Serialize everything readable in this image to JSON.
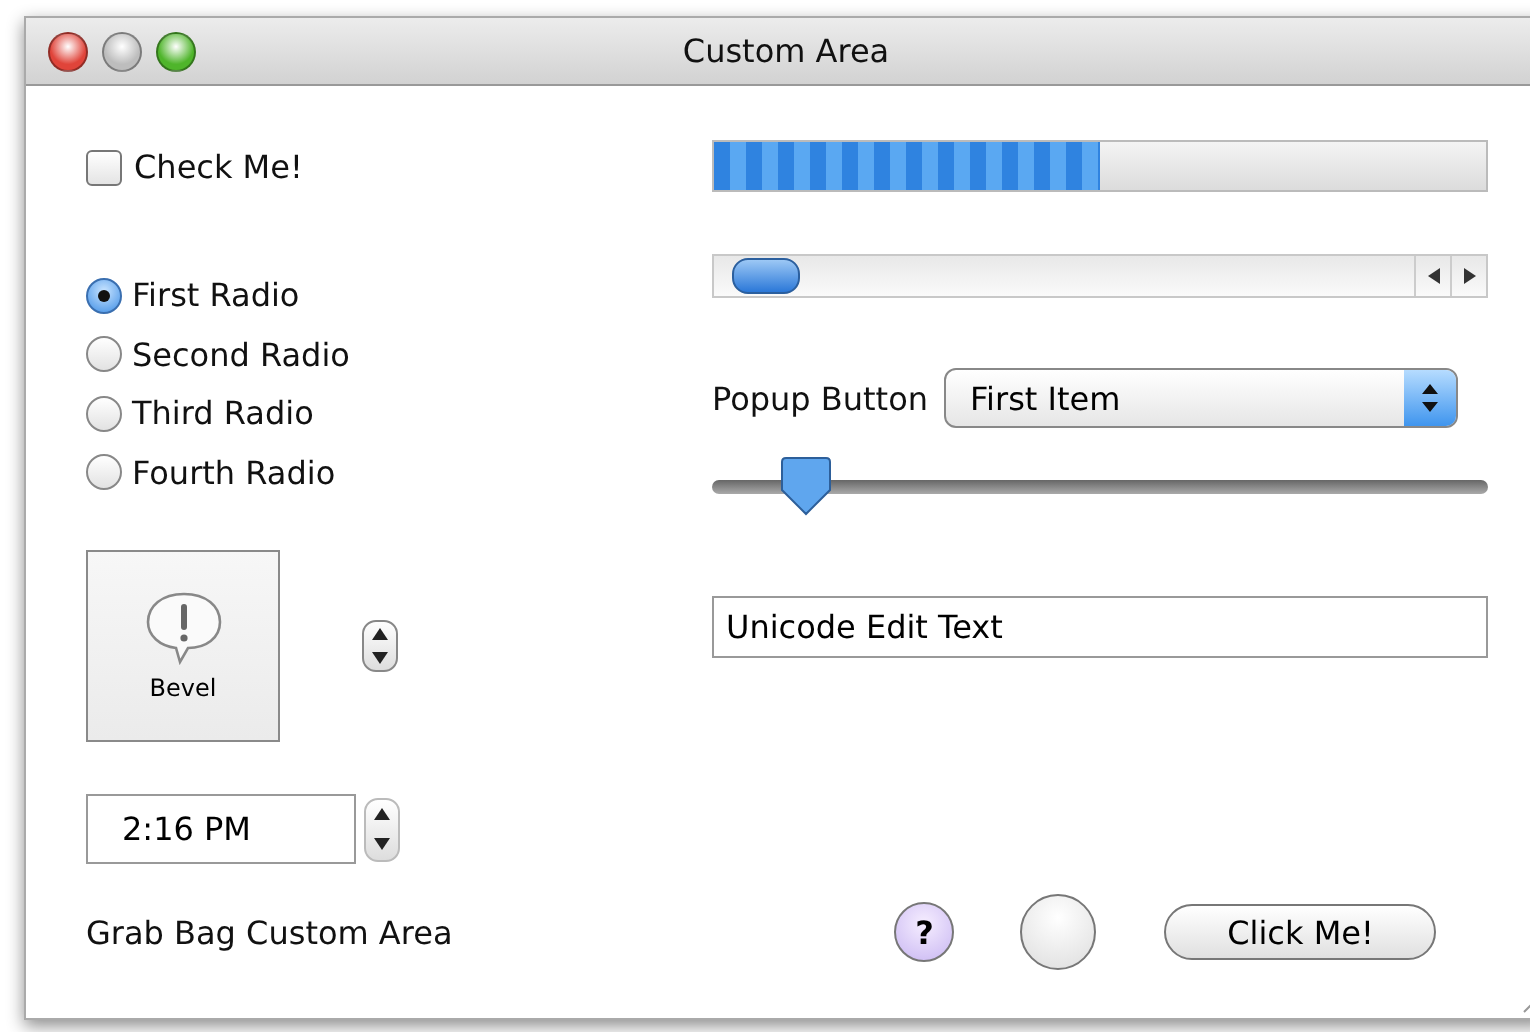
{
  "window": {
    "title": "Custom Area"
  },
  "checkbox": {
    "label": "Check Me!",
    "checked": false
  },
  "radios": [
    {
      "label": "First Radio",
      "selected": true
    },
    {
      "label": "Second Radio",
      "selected": false
    },
    {
      "label": "Third Radio",
      "selected": false
    },
    {
      "label": "Fourth Radio",
      "selected": false
    }
  ],
  "bevel_button": {
    "label": "Bevel"
  },
  "time_field": {
    "value": "2:16 PM"
  },
  "progress": {
    "level": 0.5
  },
  "popup": {
    "label": "Popup Button",
    "value": "First Item"
  },
  "slider": {
    "level": 0.12
  },
  "text_field": {
    "value": "Unicode Edit Text"
  },
  "footer": {
    "label": "Grab Bag Custom Area",
    "help": "?",
    "button": "Click Me!"
  }
}
